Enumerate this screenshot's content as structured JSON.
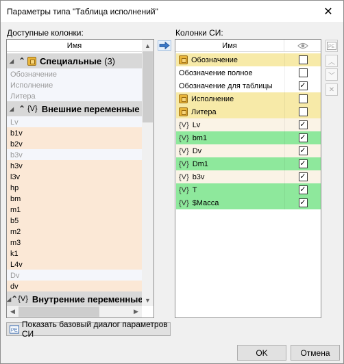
{
  "window": {
    "title": "Параметры типа \"Таблица исполнений\""
  },
  "left": {
    "label": "Доступные колонки:",
    "header": "Имя",
    "groups": {
      "special": {
        "name": "Специальные",
        "count": "(3)",
        "items": [
          "Обозначение",
          "Исполнение",
          "Литера"
        ]
      },
      "external": {
        "glyph": "{V}",
        "name": "Внешние переменные",
        "items": [
          "Lv",
          "b1v",
          "b2v",
          "b3v",
          "h3v",
          "l3v",
          "hp",
          "bm",
          "m1",
          "b5",
          "m2",
          "m3",
          "k1",
          "L4v",
          "Dv",
          "dv"
        ]
      },
      "internal": {
        "glyph": "{V}",
        "name": "Внутренние переменные"
      }
    }
  },
  "right": {
    "label": "Колонки СИ:",
    "header_name": "Имя",
    "header_visibility_icon": "eye-icon",
    "rows": [
      {
        "icon": "folder",
        "name": "Обозначение",
        "checked": false,
        "bg": "yellow"
      },
      {
        "icon": "",
        "name": "Обозначение полное",
        "checked": false,
        "bg": "white"
      },
      {
        "icon": "",
        "name": "Обозначение для таблицы",
        "checked": true,
        "bg": "white"
      },
      {
        "icon": "folder",
        "name": "Исполнение",
        "checked": false,
        "bg": "yellow"
      },
      {
        "icon": "folder",
        "name": "Литера",
        "checked": false,
        "bg": "yellow"
      },
      {
        "icon": "var",
        "name": "Lv",
        "checked": true,
        "bg": "cream"
      },
      {
        "icon": "var",
        "name": "bm1",
        "checked": true,
        "bg": "green"
      },
      {
        "icon": "var",
        "name": "Dv",
        "checked": true,
        "bg": "cream"
      },
      {
        "icon": "var",
        "name": "Dm1",
        "checked": true,
        "bg": "green"
      },
      {
        "icon": "var",
        "name": "b3v",
        "checked": true,
        "bg": "cream"
      },
      {
        "icon": "var",
        "name": "T",
        "checked": true,
        "bg": "green"
      },
      {
        "icon": "var",
        "name": "$Масса",
        "checked": true,
        "bg": "green"
      }
    ]
  },
  "var_glyph": "{V}",
  "check_glyph": "✓",
  "bottom": {
    "base_dialog_label": "Показать базовый диалог параметров СИ"
  },
  "buttons": {
    "ok": "OK",
    "cancel": "Отмена"
  },
  "colors": {
    "yellow": "#f7eaa8",
    "green": "#8ee89c",
    "peach": "#fbe8d6"
  }
}
